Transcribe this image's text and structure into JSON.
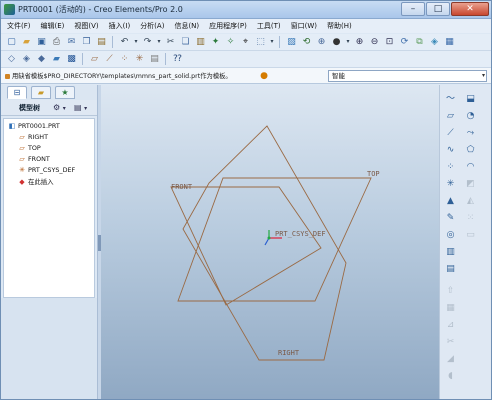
{
  "window": {
    "title": "PRT0001 (活动的) - Creo Elements/Pro 2.0",
    "controls": {
      "minimize": "–",
      "maximize": "□",
      "close": "✕"
    }
  },
  "menu": [
    "文件(F)",
    "编辑(E)",
    "视图(V)",
    "插入(I)",
    "分析(A)",
    "信息(N)",
    "应用程序(P)",
    "工具(T)",
    "窗口(W)",
    "帮助(H)"
  ],
  "message_bar": {
    "text": "用缺省模板$PRO_DIRECTORY\\templates\\mmns_part_solid.prt作为模板。",
    "filter_value": "智能",
    "filter_arrow": "▾"
  },
  "navigator": {
    "header_title": "模型树",
    "settings_icon_glyph": "⚙",
    "show_icon_glyph": "▤",
    "tree": [
      {
        "label": "PRT0001.PRT",
        "icon": "part-icon",
        "glyph": "◧",
        "color": "#2e6fb7"
      },
      {
        "label": "RIGHT",
        "icon": "datum-plane-icon",
        "glyph": "▱",
        "color": "#b35a17"
      },
      {
        "label": "TOP",
        "icon": "datum-plane-icon",
        "glyph": "▱",
        "color": "#b35a17"
      },
      {
        "label": "FRONT",
        "icon": "datum-plane-icon",
        "glyph": "▱",
        "color": "#b35a17"
      },
      {
        "label": "PRT_CSYS_DEF",
        "icon": "csys-icon",
        "glyph": "✳",
        "color": "#b35a17"
      },
      {
        "label": "在此插入",
        "icon": "insert-here-icon",
        "glyph": "◆",
        "color": "#d13232"
      }
    ]
  },
  "graphics": {
    "labels": {
      "front": "FRONT",
      "top": "TOP",
      "right": "RIGHT",
      "csys": "PRT_CSYS_DEF"
    },
    "colors": {
      "datum": "#9a6a44",
      "csys_x": "#e0203a",
      "csys_y": "#22aa44",
      "csys_z": "#2a5fd0",
      "label": "#7a5a48"
    }
  },
  "toolbar_icons": {
    "row1": [
      "new-icon",
      "open-icon",
      "save-icon",
      "print-icon",
      "email-icon",
      "copy-icon",
      "paste-icon",
      "undo-icon",
      "redo-icon",
      "cut-icon",
      "copy2-icon",
      "paste-special-icon",
      "regen-icon",
      "regen-manager-icon",
      "find-icon",
      "select-box-icon",
      "repaint-icon",
      "spin-center-icon",
      "orient-icon",
      "appearance-icon",
      "zoom-in-icon",
      "zoom-out-icon",
      "refit-icon",
      "reorient-icon",
      "saved-views-icon",
      "layers-icon",
      "view-manager-icon"
    ],
    "row2": [
      "wireframe-icon",
      "hidden-line-icon",
      "no-hidden-icon",
      "shading-icon",
      "enhanced-icon",
      "datum-planes-icon",
      "datum-axes-icon",
      "datum-points-icon",
      "csys-display-icon",
      "annotations-icon",
      "context-help-icon"
    ]
  }
}
